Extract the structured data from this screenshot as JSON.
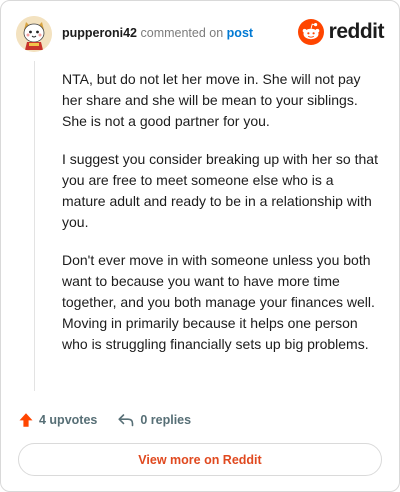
{
  "header": {
    "username": "pupperoni42",
    "commented_text": "commented on",
    "post_link": "post",
    "logo_text": "reddit"
  },
  "comment": {
    "paragraphs": [
      "NTA, but do not let her move in. She will not pay her share and she will be mean to your siblings. She is not a good partner for you.",
      "I suggest you consider breaking up with her so that you are free to meet someone else who is a mature adult and ready to be in a relationship with you.",
      "Don't ever move in with someone unless you both want to because you want to have more time together, and you both manage your finances well. Moving in primarily because it helps one person who is struggling financially sets up big problems."
    ]
  },
  "actions": {
    "upvotes": "4 upvotes",
    "replies": "0 replies"
  },
  "footer": {
    "view_more": "View more on Reddit"
  },
  "colors": {
    "brand": "#ff4500",
    "link": "#0079d3",
    "upvote": "#ff4500",
    "view_more": "#e0491f"
  },
  "icons": {
    "avatar": "avatar",
    "logo": "reddit-snoo-icon",
    "upvote": "upvote-arrow-icon",
    "reply": "reply-arrow-icon"
  }
}
